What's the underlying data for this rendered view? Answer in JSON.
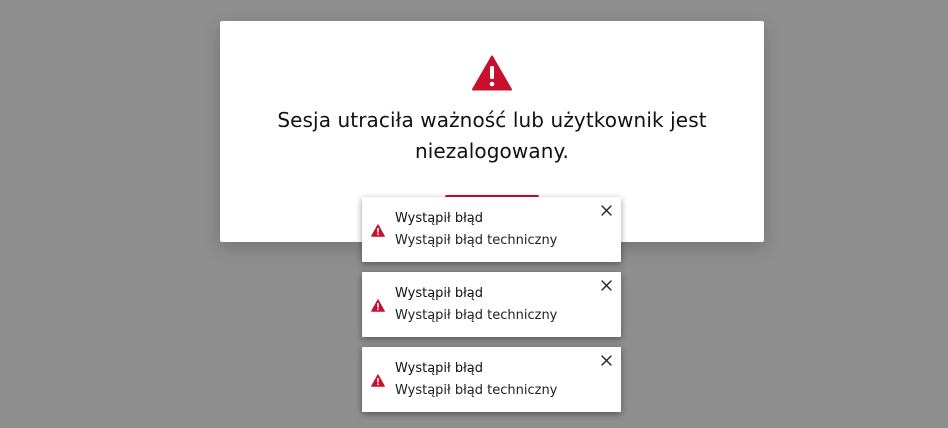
{
  "colors": {
    "accent": "#c8102e",
    "overlay": "#8e8e8e",
    "text": "#111111"
  },
  "modal": {
    "icon": "warning-triangle-icon",
    "message": "Sesja utraciła ważność lub użytkownik jest niezalogowany."
  },
  "toasts": [
    {
      "icon": "warning-triangle-icon",
      "title": "Wystąpił błąd",
      "message": "Wystąpił błąd techniczny",
      "close_icon": "close-icon"
    },
    {
      "icon": "warning-triangle-icon",
      "title": "Wystąpił błąd",
      "message": "Wystąpił błąd techniczny",
      "close_icon": "close-icon"
    },
    {
      "icon": "warning-triangle-icon",
      "title": "Wystąpił błąd",
      "message": "Wystąpił błąd techniczny",
      "close_icon": "close-icon"
    }
  ]
}
